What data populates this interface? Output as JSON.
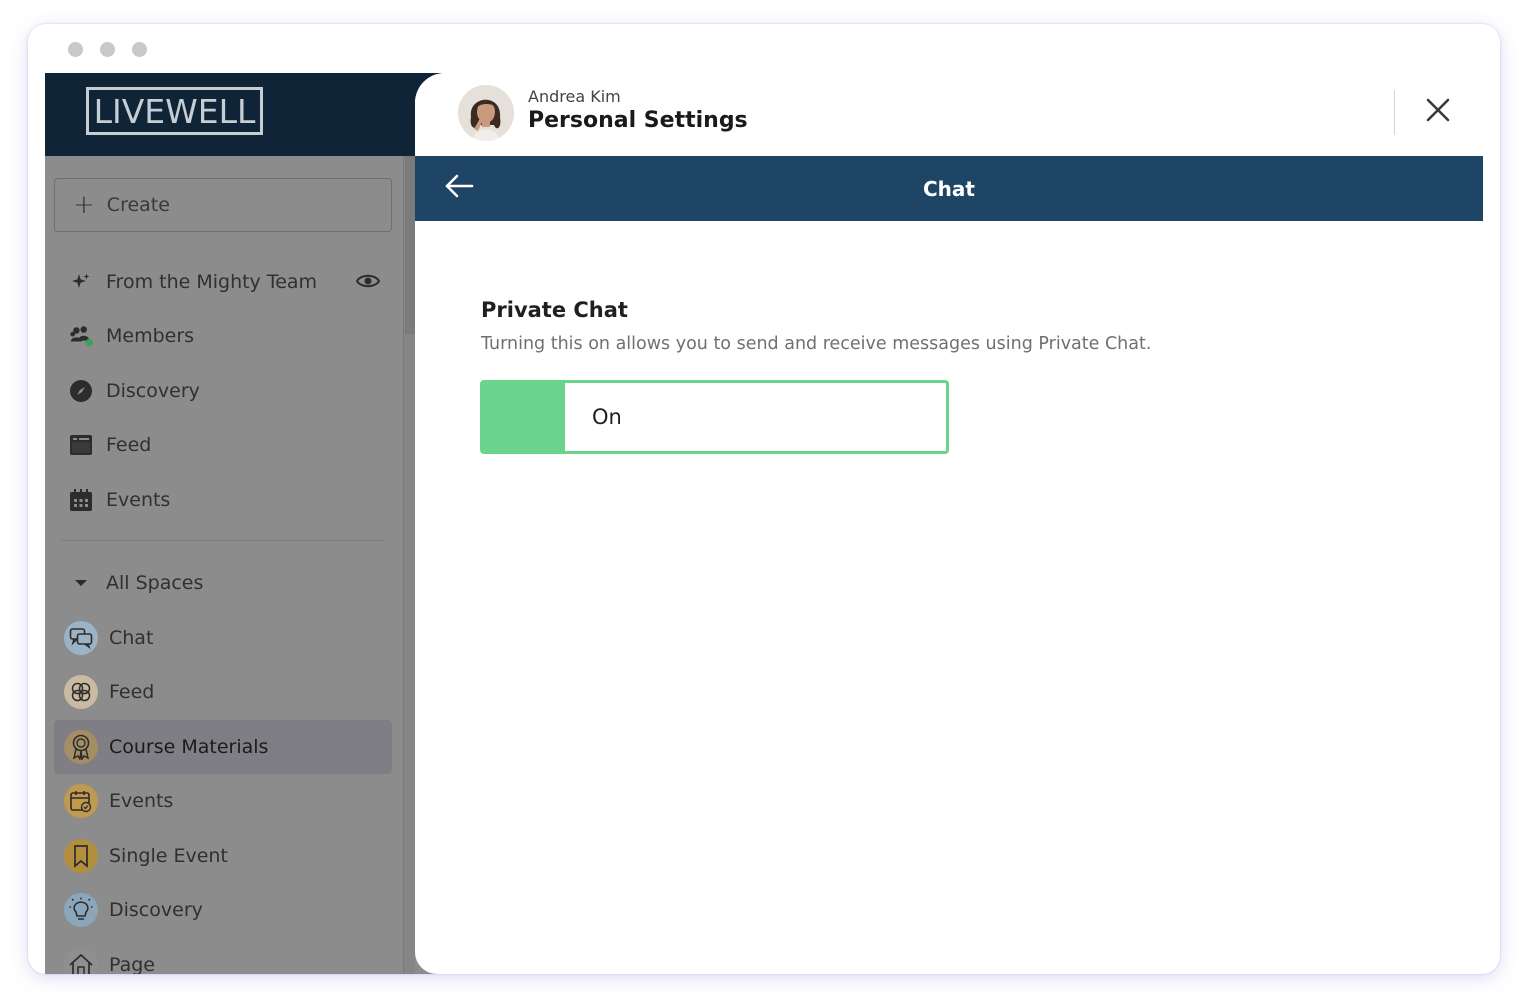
{
  "brand": {
    "logo_text": "LIVEWELL"
  },
  "sidebar": {
    "create_label": "Create",
    "items": [
      {
        "label": "From the Mighty Team",
        "icon": "sparkles-icon"
      },
      {
        "label": "Members",
        "icon": "people-icon"
      },
      {
        "label": "Discovery",
        "icon": "compass-icon"
      },
      {
        "label": "Feed",
        "icon": "feed-icon"
      },
      {
        "label": "Events",
        "icon": "calendar-icon"
      }
    ],
    "spaces_header": "All Spaces",
    "spaces": [
      {
        "label": "Chat",
        "icon": "chat-bubbles-icon",
        "color": "#9ab3c6"
      },
      {
        "label": "Feed",
        "icon": "flower-icon",
        "color": "#c9bba3"
      },
      {
        "label": "Course Materials",
        "icon": "award-ribbon-icon",
        "color": "#a68e64"
      },
      {
        "label": "Events",
        "icon": "calendar-check-icon",
        "color": "#c09a4f"
      },
      {
        "label": "Single Event",
        "icon": "bookmark-icon",
        "color": "#b38e3d"
      },
      {
        "label": "Discovery",
        "icon": "lightbulb-icon",
        "color": "#8aa6bb"
      },
      {
        "label": "Page",
        "icon": "home-icon",
        "color": "#8f8f8f"
      }
    ],
    "active_space": "Course Materials"
  },
  "panel": {
    "user_name": "Andrea Kim",
    "title": "Personal Settings",
    "subheader_title": "Chat",
    "section": {
      "title": "Private Chat",
      "description": "Turning this on allows you to send and receive messages using Private Chat."
    },
    "toggle": {
      "label": "On",
      "state": "on",
      "color": "#6bd48c"
    }
  },
  "colors": {
    "brand_dark": "#0f2436",
    "subbar": "#1e4565",
    "overlay_gray": "#8c8c8c",
    "toggle_green": "#6bd48c"
  }
}
